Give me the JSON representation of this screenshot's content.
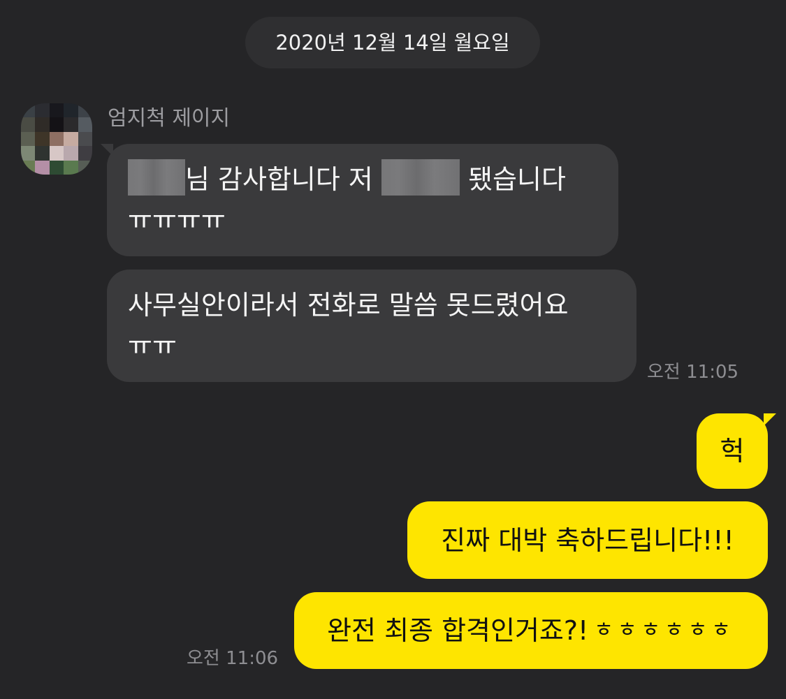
{
  "date_divider": "2020년 12월 14일 월요일",
  "sender": {
    "name": "엄지척 제이지"
  },
  "incoming": [
    {
      "line1_text": "님 감사합니다 저",
      "line1_end": "됐습니다",
      "line2": "ㅠㅠㅠㅠ"
    },
    {
      "line1": "사무실안이라서 전화로 말씀 못드렸어요",
      "line2": "ㅠㅠ"
    }
  ],
  "incoming_time": "오전 11:05",
  "outgoing": [
    {
      "text": "헉"
    },
    {
      "text": "진짜 대박 축하드립니다!!!"
    },
    {
      "text": "완전 최종 합격인거죠?!",
      "suffix": "ㅎㅎㅎㅎㅎㅎ"
    }
  ],
  "outgoing_time": "오전 11:06",
  "colors": {
    "background": "#252527",
    "incoming_bubble": "#3a3a3c",
    "outgoing_bubble": "#fee500",
    "timestamp": "#8e8e92",
    "sender_name": "#9d9da1"
  },
  "icons": {
    "avatar": "pixelated-profile-photo"
  }
}
